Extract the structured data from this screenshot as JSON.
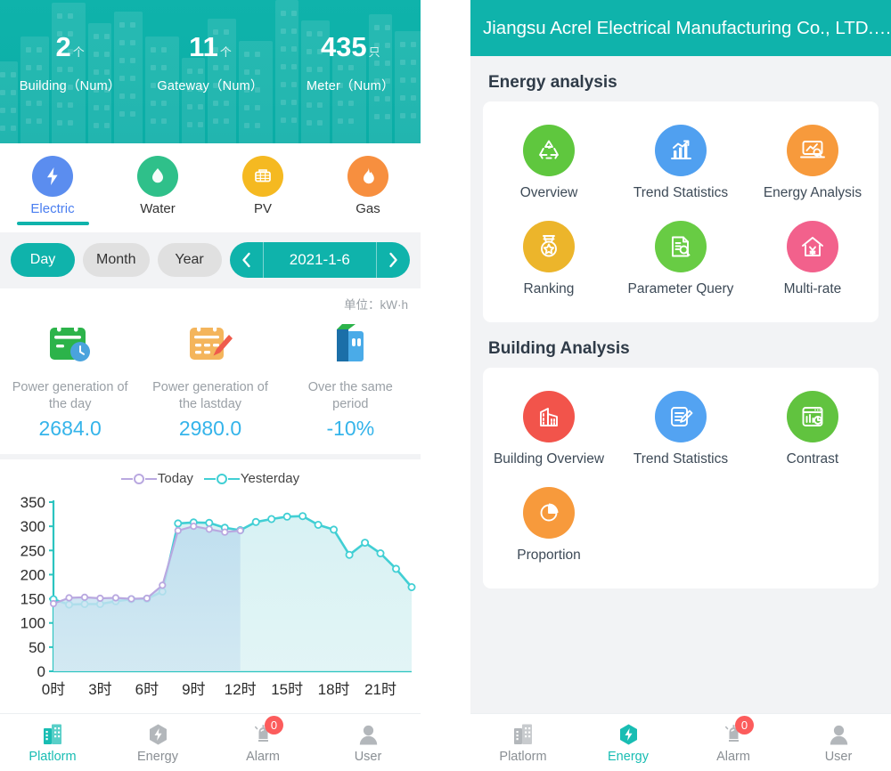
{
  "theme": {
    "teal": "#0fb3ab",
    "teal_text": "#19bdb3",
    "blue_accent": "#4a7ef0",
    "value_blue": "#35b4ea",
    "badge_red": "#fc5c5c",
    "page_bg": "#f2f3f5"
  },
  "left_screen": {
    "hero": {
      "stats": [
        {
          "value": "2",
          "unit": "个",
          "label": "Building（Num）",
          "name": "building-count"
        },
        {
          "value": "11",
          "unit": "个",
          "label": "Gateway（Num）",
          "name": "gateway-count"
        },
        {
          "value": "435",
          "unit": "只",
          "label": "Meter（Num）",
          "name": "meter-count"
        }
      ]
    },
    "categories": [
      {
        "label": "Electric",
        "icon": "lightning-bolt-icon",
        "color": "#5b8def",
        "active": true
      },
      {
        "label": "Water",
        "icon": "water-drop-icon",
        "color": "#2fc08a",
        "active": false
      },
      {
        "label": "PV",
        "icon": "solar-panel-icon",
        "color": "#f5b921",
        "active": false
      },
      {
        "label": "Gas",
        "icon": "flame-icon",
        "color": "#f78f3f",
        "active": false
      }
    ],
    "period_tabs": [
      {
        "label": "Day",
        "active": true
      },
      {
        "label": "Month",
        "active": false
      },
      {
        "label": "Year",
        "active": false
      }
    ],
    "date_selector": {
      "prev_icon": "chevron-left-icon",
      "value": "2021-1-6",
      "next_icon": "chevron-right-icon"
    },
    "summary": {
      "unit_note": "单位：kW·h",
      "cells": [
        {
          "title": "Power generation of the day",
          "value": "2684.0",
          "icon": "calendar-clock-icon"
        },
        {
          "title": "Power generation of the lastday",
          "value": "2980.0",
          "icon": "calendar-edit-icon"
        },
        {
          "title": "Over the same period",
          "value": "-10%",
          "icon": "books-icon"
        }
      ]
    },
    "tabbar": [
      {
        "label": "Platlorm",
        "icon": "building-icon",
        "active": true,
        "badge": null
      },
      {
        "label": "Energy",
        "icon": "energy-bolt-icon",
        "active": false,
        "badge": null
      },
      {
        "label": "Alarm",
        "icon": "alarm-bell-icon",
        "active": false,
        "badge": "0"
      },
      {
        "label": "User",
        "icon": "user-icon",
        "active": false,
        "badge": null
      }
    ]
  },
  "right_screen": {
    "navbar": {
      "title": "Jiangsu Acrel Electrical Manufacturing Co., LTD.…"
    },
    "sections": [
      {
        "title": "Energy analysis",
        "items": [
          {
            "label": "Overview",
            "icon": "recycle-icon",
            "color": "#5fc73e"
          },
          {
            "label": "Trend Statistics",
            "icon": "bar-chart-trend-icon",
            "color": "#50a0f0"
          },
          {
            "label": "Energy Analysis",
            "icon": "laptop-analysis-icon",
            "color": "#f79a3c"
          },
          {
            "label": "Ranking",
            "icon": "medal-icon",
            "color": "#ecb52b"
          },
          {
            "label": "Parameter Query",
            "icon": "document-search-icon",
            "color": "#68cc44"
          },
          {
            "label": "Multi-rate",
            "icon": "house-yuan-icon",
            "color": "#f2618c"
          }
        ]
      },
      {
        "title": "Building Analysis",
        "items": [
          {
            "label": "Building Overview",
            "icon": "building-block-icon",
            "color": "#f2544b"
          },
          {
            "label": "Trend Statistics",
            "icon": "document-edit-icon",
            "color": "#53a3f2"
          },
          {
            "label": "Contrast",
            "icon": "browser-chart-icon",
            "color": "#61c33f"
          },
          {
            "label": "Proportion",
            "icon": "pie-chart-icon",
            "color": "#f79a3c"
          }
        ]
      }
    ],
    "tabbar": [
      {
        "label": "Platlorm",
        "icon": "building-icon",
        "active": false,
        "badge": null
      },
      {
        "label": "Energy",
        "icon": "energy-bolt-icon",
        "active": true,
        "badge": null
      },
      {
        "label": "Alarm",
        "icon": "alarm-bell-icon",
        "active": false,
        "badge": "0"
      },
      {
        "label": "User",
        "icon": "user-icon",
        "active": false,
        "badge": null
      }
    ]
  },
  "chart_data": {
    "type": "line",
    "title": "",
    "xlabel": "",
    "ylabel": "",
    "ylim": [
      0,
      350
    ],
    "yticks": [
      0,
      50,
      100,
      150,
      200,
      250,
      300,
      350
    ],
    "xticks": [
      "0时",
      "3时",
      "6时",
      "9时",
      "12时",
      "15时",
      "18时",
      "21时"
    ],
    "x": [
      0,
      1,
      2,
      3,
      4,
      5,
      6,
      7,
      8,
      9,
      10,
      11,
      12,
      13,
      14,
      15,
      16,
      17,
      18,
      19,
      20,
      21,
      22,
      23
    ],
    "grid": false,
    "legend_position": "top-center",
    "series": [
      {
        "name": "Today",
        "color": "#b9a8e0",
        "values": [
          140,
          152,
          153,
          151,
          152,
          150,
          151,
          178,
          291,
          300,
          294,
          288,
          291,
          null,
          null,
          null,
          null,
          null,
          null,
          null,
          null,
          null,
          null,
          null
        ]
      },
      {
        "name": "Yesterday",
        "color": "#41cfd4",
        "values": [
          149,
          138,
          139,
          139,
          145,
          149,
          150,
          165,
          306,
          308,
          307,
          297,
          292,
          309,
          315,
          320,
          321,
          303,
          293,
          241,
          266,
          244,
          212,
          174
        ]
      }
    ]
  }
}
